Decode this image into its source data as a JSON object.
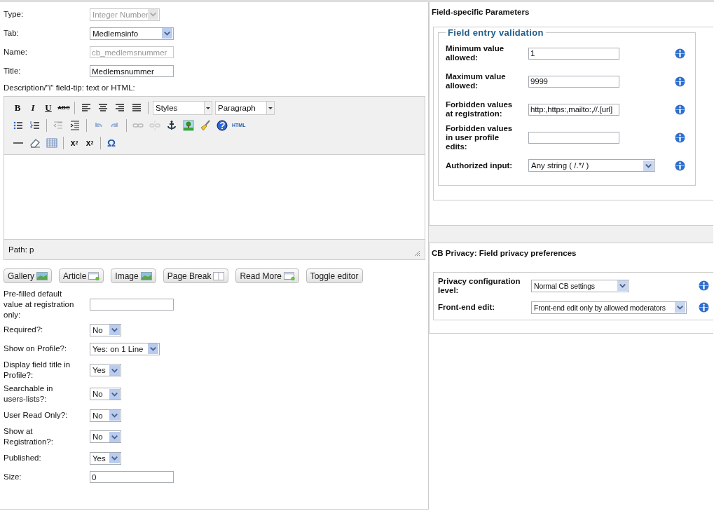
{
  "top_fields": [
    {
      "label": "Type:",
      "kind": "select",
      "value": "Integer Number",
      "disabled": true
    },
    {
      "label": "Tab:",
      "kind": "select",
      "value": "Medlemsinfo",
      "disabled": false
    },
    {
      "label": "Name:",
      "kind": "input",
      "value": "cb_medlemsnummer",
      "disabled": true
    },
    {
      "label": "Title:",
      "kind": "input",
      "value": "Medlemsnummer",
      "disabled": false
    }
  ],
  "description_label": "Description/\"i\" field-tip: text or HTML:",
  "editor": {
    "glyphs": {
      "bold": "B",
      "italic": "I",
      "underline": "U",
      "strike": "ABC",
      "html": "HTML",
      "sub": "x",
      "sub_mark": "2",
      "sup": "x",
      "sup_mark": "2",
      "omega": "Ω"
    },
    "styles_select": "Styles",
    "format_select": "Paragraph",
    "path": "Path: p"
  },
  "editor_buttons": [
    {
      "label": "Gallery"
    },
    {
      "label": "Article"
    },
    {
      "label": "Image"
    },
    {
      "label": "Page Break"
    },
    {
      "label": "Read More"
    },
    {
      "label": "Toggle editor"
    }
  ],
  "bottom_fields": [
    {
      "label": "Pre-filled default value at registration only:",
      "kind": "input"
    },
    {
      "label": "Required?:",
      "kind": "select",
      "value": "No"
    },
    {
      "label": "Show on Profile?:",
      "kind": "select",
      "value": "Yes: on 1 Line"
    },
    {
      "label": "Display field title in Profile?:",
      "kind": "select",
      "value": "Yes"
    },
    {
      "label": "Searchable in users-lists?:",
      "kind": "select",
      "value": "No"
    },
    {
      "label": "User Read Only?:",
      "kind": "select",
      "value": "No"
    },
    {
      "label": "Show at Registration?:",
      "kind": "select",
      "value": "No"
    },
    {
      "label": "Published:",
      "kind": "select",
      "value": "Yes"
    },
    {
      "label": "Size:",
      "kind": "input",
      "value": "0"
    }
  ],
  "field_params": {
    "title": "Field-specific Parameters",
    "legend": "Field entry validation",
    "rows": [
      {
        "label": "Minimum value allowed:",
        "kind": "input",
        "value": "1"
      },
      {
        "label": "Maximum value allowed:",
        "kind": "input",
        "value": "9999"
      },
      {
        "label": "Forbidden values at registration:",
        "kind": "input",
        "value": "http:,https:,mailto:,//.[url]"
      },
      {
        "label": "Forbidden values in user profile edits:",
        "kind": "input"
      },
      {
        "label": "Authorized input:",
        "kind": "select",
        "value": "Any string ( /.*/ )"
      }
    ]
  },
  "privacy": {
    "title": "CB Privacy: Field privacy preferences",
    "rows": [
      {
        "label": "Privacy configuration level:",
        "kind": "select",
        "value": "Normal CB settings"
      },
      {
        "label": "Front-end edit:",
        "kind": "select",
        "value": "Front-end edit only by allowed moderators"
      }
    ]
  }
}
